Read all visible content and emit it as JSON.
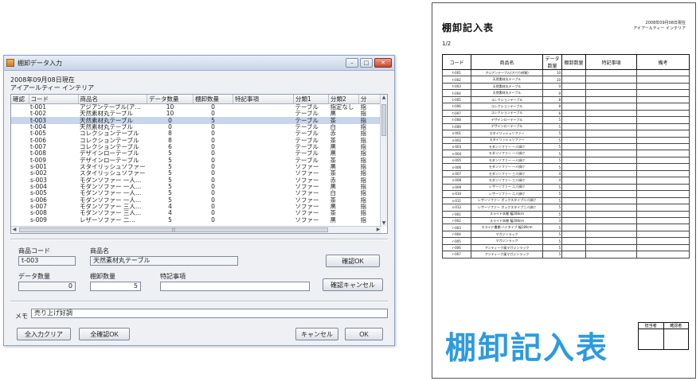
{
  "window": {
    "title": "棚卸データ入力",
    "date_line": "2008年09月08日現在",
    "company": "アイアールティー インテリア"
  },
  "grid": {
    "columns": [
      "確認",
      "コード",
      "商品名",
      "データ数量",
      "棚卸数量",
      "特記事項",
      "分類1",
      "分類2",
      "分"
    ],
    "rows": [
      {
        "code": "t-001",
        "name": "アジアンテーブル(ア…",
        "data_qty": "10",
        "count_qty": "0",
        "note": "",
        "cat1": "テーブル",
        "cat2": "指定なし",
        "cat3": "指"
      },
      {
        "code": "t-002",
        "name": "天然素材丸テーブル",
        "data_qty": "10",
        "count_qty": "0",
        "note": "",
        "cat1": "テーブル",
        "cat2": "黒",
        "cat3": "指"
      },
      {
        "code": "t-003",
        "name": "天然素材丸テーブル",
        "data_qty": "0",
        "count_qty": "5",
        "note": "",
        "cat1": "テーブル",
        "cat2": "茶",
        "cat3": "指"
      },
      {
        "code": "t-004",
        "name": "天然素材丸テーブル",
        "data_qty": "0",
        "count_qty": "0",
        "note": "",
        "cat1": "テーブル",
        "cat2": "白",
        "cat3": "指"
      },
      {
        "code": "t-005",
        "name": "コレクションテーブル",
        "data_qty": "8",
        "count_qty": "0",
        "note": "",
        "cat1": "テーブル",
        "cat2": "赤",
        "cat3": "指"
      },
      {
        "code": "t-006",
        "name": "コレクションテーブル",
        "data_qty": "8",
        "count_qty": "0",
        "note": "",
        "cat1": "テーブル",
        "cat2": "茶",
        "cat3": "指"
      },
      {
        "code": "t-007",
        "name": "コレクションテーブル",
        "data_qty": "6",
        "count_qty": "0",
        "note": "",
        "cat1": "テーブル",
        "cat2": "黒",
        "cat3": "指"
      },
      {
        "code": "t-008",
        "name": "デザインローテーブル",
        "data_qty": "5",
        "count_qty": "0",
        "note": "",
        "cat1": "テーブル",
        "cat2": "黒",
        "cat3": "指"
      },
      {
        "code": "t-009",
        "name": "デザインローテーブル",
        "data_qty": "5",
        "count_qty": "0",
        "note": "",
        "cat1": "テーブル",
        "cat2": "茶",
        "cat3": "指"
      },
      {
        "code": "s-001",
        "name": "スタイリッシュソファー",
        "data_qty": "5",
        "count_qty": "0",
        "note": "",
        "cat1": "ソファー",
        "cat2": "黒",
        "cat3": "指"
      },
      {
        "code": "s-002",
        "name": "スタイリッシュソファー",
        "data_qty": "5",
        "count_qty": "0",
        "note": "",
        "cat1": "ソファー",
        "cat2": "茶",
        "cat3": "指"
      },
      {
        "code": "s-003",
        "name": "モダンソファー 一人…",
        "data_qty": "5",
        "count_qty": "0",
        "note": "",
        "cat1": "ソファー",
        "cat2": "赤",
        "cat3": "指"
      },
      {
        "code": "s-004",
        "name": "モダンソファー 一人…",
        "data_qty": "5",
        "count_qty": "0",
        "note": "",
        "cat1": "ソファー",
        "cat2": "黒",
        "cat3": "指"
      },
      {
        "code": "s-005",
        "name": "モダンソファー 一人…",
        "data_qty": "5",
        "count_qty": "0",
        "note": "",
        "cat1": "ソファー",
        "cat2": "白",
        "cat3": "指"
      },
      {
        "code": "s-006",
        "name": "モダンソファー 一人…",
        "data_qty": "5",
        "count_qty": "0",
        "note": "",
        "cat1": "ソファー",
        "cat2": "茶",
        "cat3": "指"
      },
      {
        "code": "s-007",
        "name": "モダンソファー 三人…",
        "data_qty": "4",
        "count_qty": "0",
        "note": "",
        "cat1": "ソファー",
        "cat2": "黒",
        "cat3": "指"
      },
      {
        "code": "s-008",
        "name": "モダンソファー 三人…",
        "data_qty": "4",
        "count_qty": "0",
        "note": "",
        "cat1": "ソファー",
        "cat2": "茶",
        "cat3": "指"
      },
      {
        "code": "s-009",
        "name": "レザーソファー 二…",
        "data_qty": "5",
        "count_qty": "0",
        "note": "",
        "cat1": "ソファー",
        "cat2": "黒",
        "cat3": "指"
      }
    ],
    "selected_row": 2
  },
  "form": {
    "code_label": "商品コード",
    "code_value": "t-003",
    "name_label": "商品名",
    "name_value": "天然素材丸テーブル",
    "data_qty_label": "データ数量",
    "data_qty_value": "0",
    "count_qty_label": "棚卸数量",
    "count_qty_value": "5",
    "note_label": "特記事項",
    "note_value": "",
    "confirm_ok": "確認OK",
    "confirm_cancel": "確認キャンセル",
    "memo_label": "メモ",
    "memo_value": "売り上げ好調"
  },
  "footer": {
    "clear_all": "全入力クリア",
    "all_ok": "全確認OK",
    "cancel": "キャンセル",
    "ok": "OK"
  },
  "sheet": {
    "title": "棚卸記入表",
    "date_line": "2008年09月08日現在",
    "company": "アイアールティー インテリア",
    "page": "1/2",
    "columns": [
      "コード",
      "商品名",
      "データ数量",
      "棚卸数量",
      "特記事項",
      "備考"
    ],
    "rows": [
      [
        "t-001",
        "アジアンテーブル(アバカ材質)",
        "10"
      ],
      [
        "t-002",
        "天然素材丸テーブル",
        "10"
      ],
      [
        "t-003",
        "天然素材丸テーブル",
        "0"
      ],
      [
        "t-004",
        "天然素材丸テーブル",
        "0"
      ],
      [
        "t-005",
        "コレクションテーブル",
        "8"
      ],
      [
        "t-006",
        "コレクションテーブル",
        "8"
      ],
      [
        "t-007",
        "コレクションテーブル",
        "6"
      ],
      [
        "t-008",
        "デザインローテーブル",
        "5"
      ],
      [
        "t-009",
        "デザインローテーブル",
        "5"
      ],
      [
        "s-001",
        "スタイリッシュソファー",
        "5"
      ],
      [
        "s-002",
        "スタイリッシュソファー",
        "5"
      ],
      [
        "s-003",
        "モダンソファー 一人掛け",
        "5"
      ],
      [
        "s-004",
        "モダンソファー 一人掛け",
        "5"
      ],
      [
        "s-005",
        "モダンソファー 一人掛け",
        "5"
      ],
      [
        "s-006",
        "モダンソファー 一人掛け",
        "5"
      ],
      [
        "s-007",
        "モダンソファー 三人掛け",
        "4"
      ],
      [
        "s-008",
        "モダンソファー 三人掛け",
        "4"
      ],
      [
        "s-009",
        "レザーソファー 二人掛け",
        "5"
      ],
      [
        "s-010",
        "レザーソファー 二人掛け",
        "5"
      ],
      [
        "s-011",
        "レザーソファー ボックスタイプ二人掛け",
        "5"
      ],
      [
        "s-012",
        "レザーソファー ボックスタイプ三人掛け",
        "5"
      ],
      [
        "r-001",
        "スライド本棚 幅208cm",
        "5"
      ],
      [
        "r-002",
        "スライド本棚 幅208cm",
        "3"
      ],
      [
        "r-003",
        "スライド書棚 ハイタイプ 幅180cm",
        "5"
      ],
      [
        "r-004",
        "マガジンラック",
        "5"
      ],
      [
        "r-005",
        "マガジンラック",
        "5"
      ],
      [
        "r-006",
        "アンティーク風マガジンラック",
        "5"
      ],
      [
        "r-007",
        "アンティーク風マガジンラック",
        "5"
      ]
    ],
    "big_title": "棚卸記入表",
    "stamp_labels": [
      "担当者",
      "確認者"
    ]
  }
}
